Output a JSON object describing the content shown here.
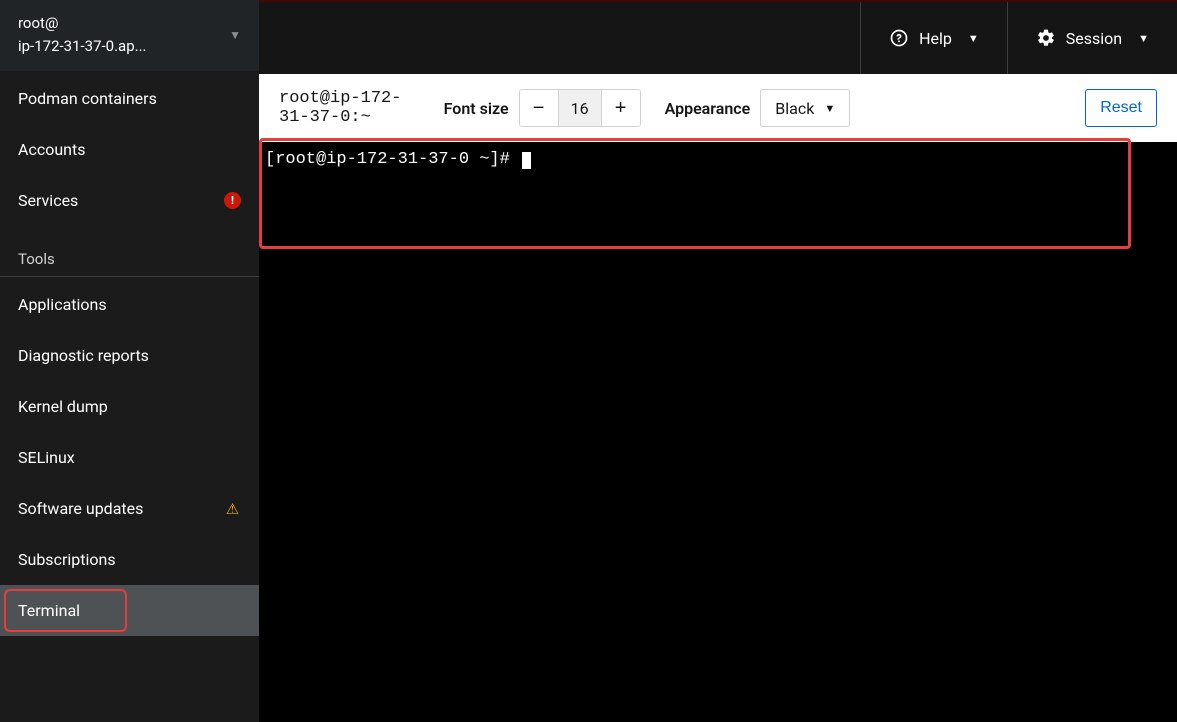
{
  "host": {
    "line1": "root@",
    "line2": "ip-172-31-37-0.ap..."
  },
  "sidebar_top": [
    {
      "label": "Podman containers"
    },
    {
      "label": "Accounts"
    },
    {
      "label": "Services",
      "warn": "circle"
    }
  ],
  "tools_label": "Tools",
  "sidebar_tools": [
    {
      "label": "Applications"
    },
    {
      "label": "Diagnostic reports"
    },
    {
      "label": "Kernel dump"
    },
    {
      "label": "SELinux"
    },
    {
      "label": "Software updates",
      "warn": "tri"
    },
    {
      "label": "Subscriptions"
    },
    {
      "label": "Terminal",
      "active": true
    }
  ],
  "topbar": {
    "help": "Help",
    "session": "Session"
  },
  "toolbar": {
    "path": "root@ip-172-31-37-0:~",
    "fontsize_label": "Font size",
    "fontsize_value": "16",
    "appearance_label": "Appearance",
    "appearance_value": "Black",
    "reset": "Reset"
  },
  "terminal": {
    "prompt": "[root@ip-172-31-37-0 ~]# "
  }
}
